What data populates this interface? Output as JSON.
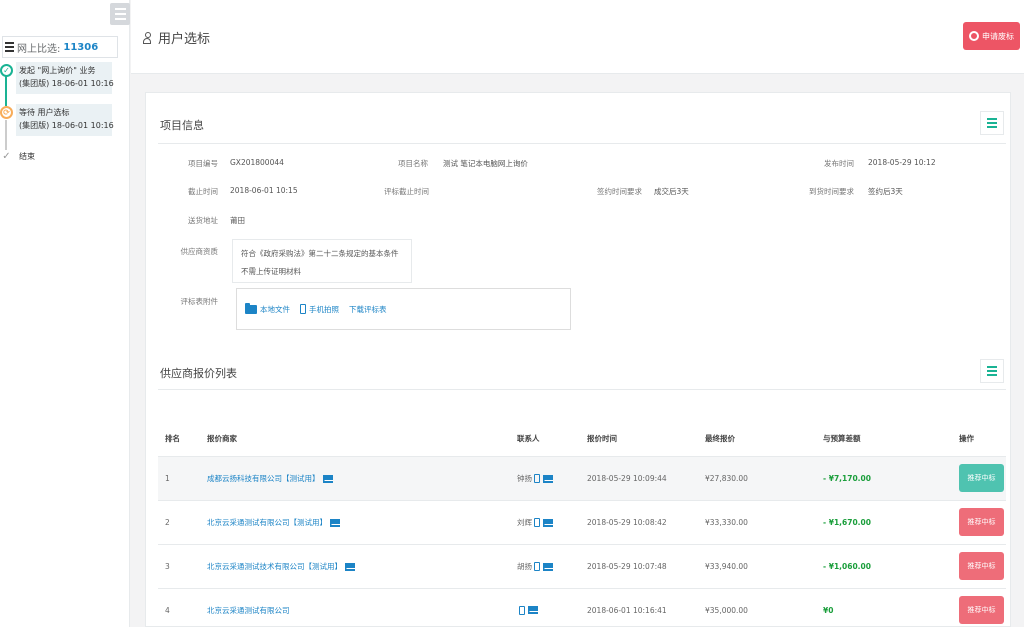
{
  "sidebar": {
    "project_label": "网上比选:",
    "project_number": "11306",
    "timeline": [
      {
        "status": "done",
        "line1": "发起 \"网上询价\" 业务",
        "line2": "(集团版) 18-06-01 10:16"
      },
      {
        "status": "active",
        "line1": "等待 用户选标",
        "line2": "(集团版) 18-06-01 10:16"
      },
      {
        "status": "end",
        "line1": "结束",
        "line2": ""
      }
    ]
  },
  "header": {
    "title": "用户选标",
    "apply_button": "申请废标"
  },
  "project_info": {
    "section_title": "项目信息",
    "fields": {
      "project_code_label": "项目编号",
      "project_code": "GX201800044",
      "project_name_label": "项目名称",
      "project_name": "测试  笔记本电脑网上询价",
      "publish_time_label": "发布时间",
      "publish_time": "2018-05-29 10:12",
      "deadline_label": "截止时间",
      "deadline": "2018-06-01 10:15",
      "evaluation_deadline_label": "评标截止时间",
      "evaluation_deadline": "",
      "signing_requirement_label": "签约时间要求",
      "signing_requirement": "成交后3天",
      "arrival_requirement_label": "到货时间要求",
      "arrival_requirement": "签约后3天",
      "delivery_address_label": "送货地址",
      "delivery_address": "莆田",
      "supplier_req_label": "供应商资质",
      "supplier_req_line1": "符合《政府采购法》第二十二条规定的基本条件",
      "supplier_req_line2": "不需上传证明材料",
      "attachments_label": "评标表附件",
      "attachments": {
        "local_file": "本地文件",
        "mobile_upload": "手机拍照",
        "download_form": "下载评标表"
      }
    }
  },
  "quotes": {
    "section_title": "供应商报价列表",
    "columns": [
      "排名",
      "报价商家",
      "联系人",
      "报价时间",
      "最终报价",
      "与预算差额",
      "操作"
    ],
    "rows": [
      {
        "rank": "1",
        "supplier": "成都云扬科技有限公司【测试用】",
        "contact": "钟扬",
        "time": "2018-05-29 10:09:44",
        "price": "¥27,830.00",
        "diff": "- ¥7,170.00",
        "action": "推荐中标",
        "action_style": "teal"
      },
      {
        "rank": "2",
        "supplier": "北京云采通测试有限公司【测试用】",
        "contact": "刘辉",
        "time": "2018-05-29 10:08:42",
        "price": "¥33,330.00",
        "diff": "- ¥1,670.00",
        "action": "推荐中标",
        "action_style": "red"
      },
      {
        "rank": "3",
        "supplier": "北京云采通测试技术有限公司【测试用】",
        "contact": "胡扬",
        "time": "2018-05-29 10:07:48",
        "price": "¥33,940.00",
        "diff": "- ¥1,060.00",
        "action": "推荐中标",
        "action_style": "red"
      },
      {
        "rank": "4",
        "supplier": "北京云采通测试有限公司",
        "contact": "",
        "time": "2018-06-01 10:16:41",
        "price": "¥35,000.00",
        "diff": "¥0",
        "action": "推荐中标",
        "action_style": "red"
      }
    ]
  }
}
